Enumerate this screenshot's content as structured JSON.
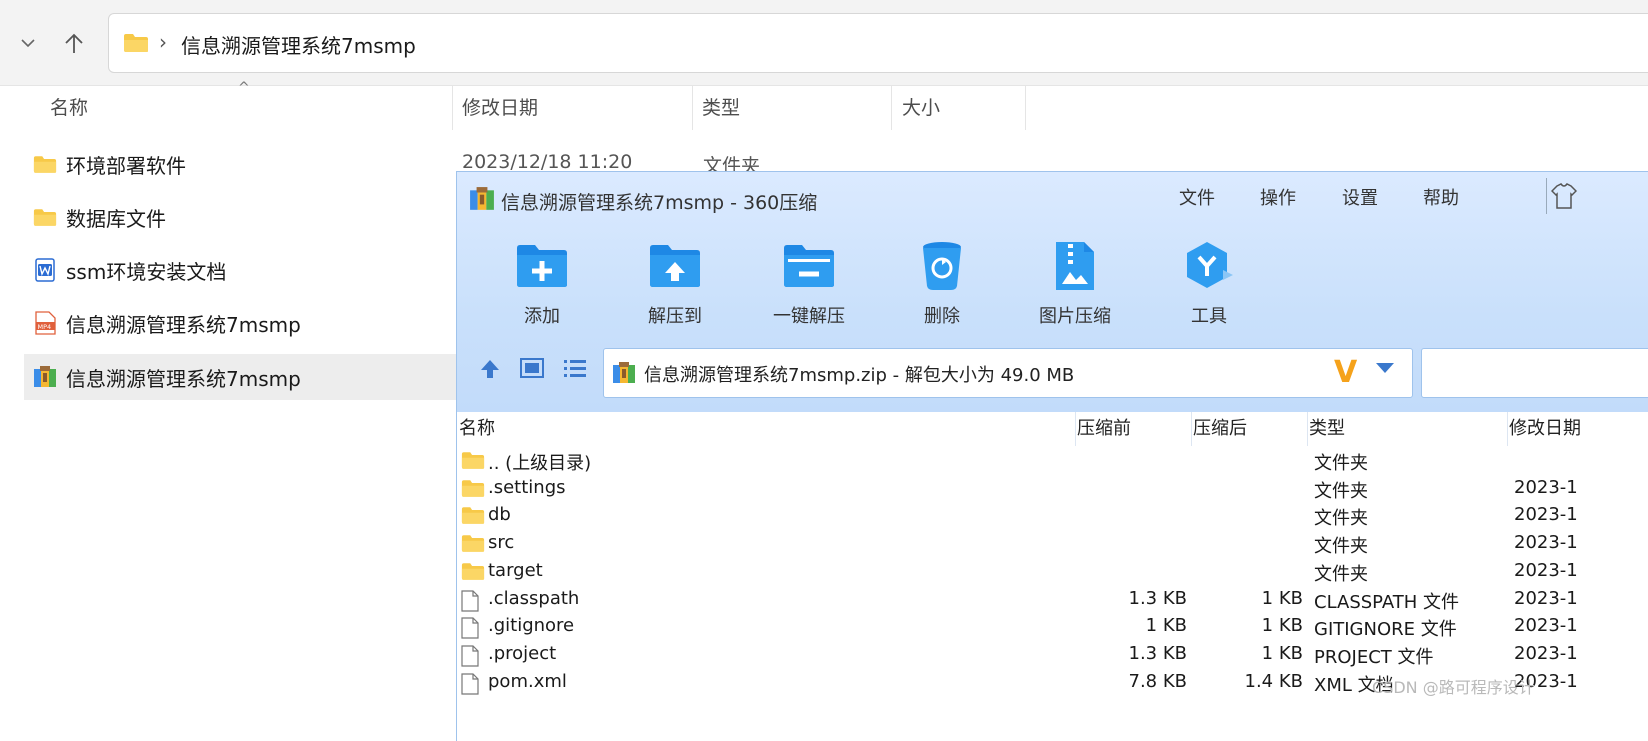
{
  "explorer": {
    "path": "信息溯源管理系统7msmp",
    "columns": {
      "name": "名称",
      "date": "修改日期",
      "type": "类型",
      "size": "大小"
    },
    "items": [
      {
        "name": "环境部署软件",
        "icon": "folder-icon",
        "date": "2023/12/18 11:20",
        "type": "文件夹"
      },
      {
        "name": "数据库文件",
        "icon": "folder-icon"
      },
      {
        "name": "ssm环境安装文档",
        "icon": "word-doc-icon"
      },
      {
        "name": "信息溯源管理系统7msmp",
        "icon": "mp4-icon"
      },
      {
        "name": "信息溯源管理系统7msmp",
        "icon": "zip-archive-icon",
        "selected": true
      }
    ]
  },
  "archiver": {
    "title": "信息溯源管理系统7msmp - 360压缩",
    "menu": [
      "文件",
      "操作",
      "设置",
      "帮助"
    ],
    "toolbar": [
      {
        "label": "添加",
        "icon": "add-folder-icon"
      },
      {
        "label": "解压到",
        "icon": "extract-to-icon"
      },
      {
        "label": "一键解压",
        "icon": "one-click-extract-icon"
      },
      {
        "label": "删除",
        "icon": "recycle-bin-icon"
      },
      {
        "label": "图片压缩",
        "icon": "image-compress-icon"
      },
      {
        "label": "工具",
        "icon": "tools-icon"
      }
    ],
    "path_text": "信息溯源管理系统7msmp.zip - 解包大小为 49.0 MB",
    "columns": {
      "name": "名称",
      "before": "压缩前",
      "after": "压缩后",
      "type": "类型",
      "date": "修改日期"
    },
    "rows": [
      {
        "name": ".. (上级目录)",
        "icon": "folder-icon",
        "before": "",
        "after": "",
        "type": "文件夹",
        "date": ""
      },
      {
        "name": ".settings",
        "icon": "folder-icon",
        "before": "",
        "after": "",
        "type": "文件夹",
        "date": "2023-1"
      },
      {
        "name": "db",
        "icon": "folder-icon",
        "before": "",
        "after": "",
        "type": "文件夹",
        "date": "2023-1"
      },
      {
        "name": "src",
        "icon": "folder-icon",
        "before": "",
        "after": "",
        "type": "文件夹",
        "date": "2023-1"
      },
      {
        "name": "target",
        "icon": "folder-icon",
        "before": "",
        "after": "",
        "type": "文件夹",
        "date": "2023-1"
      },
      {
        "name": ".classpath",
        "icon": "file-icon",
        "before": "1.3 KB",
        "after": "1 KB",
        "type": "CLASSPATH 文件",
        "date": "2023-1"
      },
      {
        "name": ".gitignore",
        "icon": "file-icon",
        "before": "1 KB",
        "after": "1 KB",
        "type": "GITIGNORE 文件",
        "date": "2023-1"
      },
      {
        "name": ".project",
        "icon": "file-icon",
        "before": "1.3 KB",
        "after": "1 KB",
        "type": "PROJECT 文件",
        "date": "2023-1"
      },
      {
        "name": "pom.xml",
        "icon": "file-icon",
        "before": "7.8 KB",
        "after": "1.4 KB",
        "type": "XML 文档",
        "date": "2023-1"
      }
    ]
  },
  "watermark": "CSDN @路可程序设计",
  "colors": {
    "folder": "#f7c948",
    "accent": "#2d8cf0",
    "selection": "#ededed",
    "archiver_header": "#c9e0fb"
  }
}
